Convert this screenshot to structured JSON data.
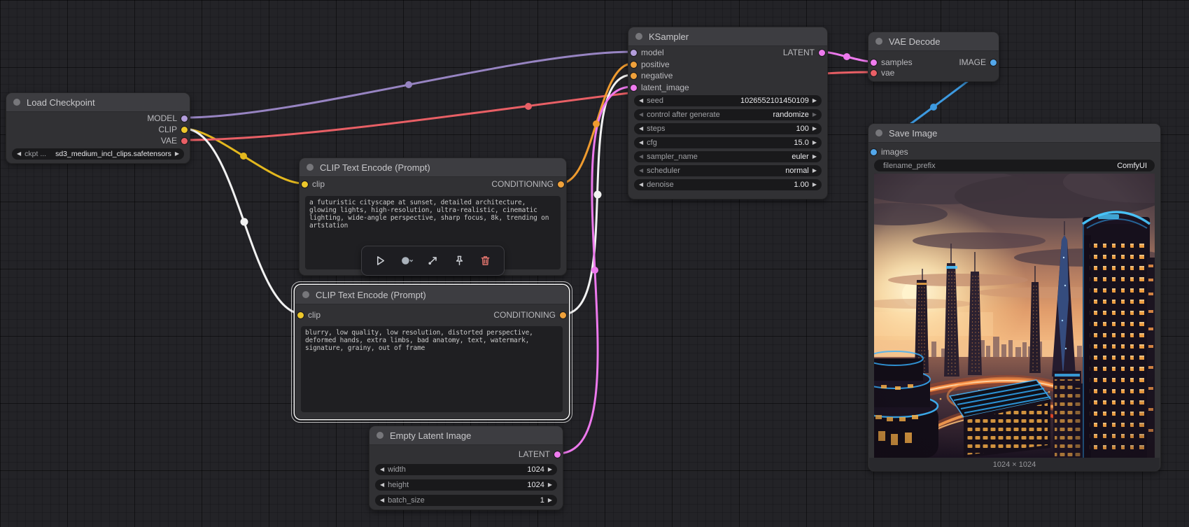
{
  "nodes": {
    "load_checkpoint": {
      "title": "Load Checkpoint",
      "outputs": [
        "MODEL",
        "CLIP",
        "VAE"
      ],
      "widgets": [
        {
          "label": "ckpt ...",
          "value": "sd3_medium_incl_clips.safetensors"
        }
      ]
    },
    "clip_positive": {
      "title": "CLIP Text Encode (Prompt)",
      "inputs": [
        "clip"
      ],
      "outputs": [
        "CONDITIONING"
      ],
      "text": "a futuristic cityscape at sunset, detailed architecture, glowing lights, high-resolution, ultra-realistic, cinematic lighting, wide-angle perspective, sharp focus, 8k, trending on artstation"
    },
    "clip_negative": {
      "title": "CLIP Text Encode (Prompt)",
      "inputs": [
        "clip"
      ],
      "outputs": [
        "CONDITIONING"
      ],
      "text": "blurry, low quality, low resolution, distorted perspective, deformed hands, extra limbs, bad anatomy, text, watermark, signature, grainy, out of frame"
    },
    "empty_latent": {
      "title": "Empty Latent Image",
      "outputs": [
        "LATENT"
      ],
      "widgets": [
        {
          "label": "width",
          "value": "1024"
        },
        {
          "label": "height",
          "value": "1024"
        },
        {
          "label": "batch_size",
          "value": "1"
        }
      ]
    },
    "ksampler": {
      "title": "KSampler",
      "inputs": [
        "model",
        "positive",
        "negative",
        "latent_image"
      ],
      "outputs": [
        "LATENT"
      ],
      "widgets": [
        {
          "label": "seed",
          "value": "1026552101450109"
        },
        {
          "label": "control after generate",
          "value": "randomize"
        },
        {
          "label": "steps",
          "value": "100"
        },
        {
          "label": "cfg",
          "value": "15.0"
        },
        {
          "label": "sampler_name",
          "value": "euler"
        },
        {
          "label": "scheduler",
          "value": "normal"
        },
        {
          "label": "denoise",
          "value": "1.00"
        }
      ]
    },
    "vae_decode": {
      "title": "VAE Decode",
      "inputs": [
        "samples",
        "vae"
      ],
      "outputs": [
        "IMAGE"
      ]
    },
    "save_image": {
      "title": "Save Image",
      "inputs": [
        "images"
      ],
      "widgets": [
        {
          "label": "filename_prefix",
          "value": "ComfyUI"
        }
      ],
      "image_caption": "1024 × 1024",
      "image_description": "futuristic cityscape at sunset with neon-lit skyscrapers and glowing traffic trails"
    }
  },
  "selection_toolbar": {
    "icons": [
      "play",
      "color-picker",
      "bypass",
      "pin",
      "delete"
    ]
  },
  "port_colors": {
    "model": "#b39ddb",
    "clip": "#eec82b",
    "vae": "#ea5f66",
    "conditioning": "#efa13b",
    "latent": "#ee7bee",
    "image": "#53a7ea",
    "highlighted_link": "#f2f2f2"
  }
}
